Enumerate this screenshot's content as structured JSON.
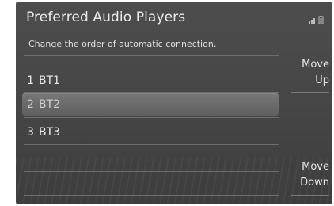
{
  "header": {
    "title": "Preferred Audio Players",
    "status_icons": [
      "signal-strength-icon",
      "battery-icon"
    ]
  },
  "instruction": "Change the order of automatic connection.",
  "players": [
    {
      "index": "1",
      "name": "BT1",
      "selected": false
    },
    {
      "index": "2",
      "name": "BT2",
      "selected": true
    },
    {
      "index": "3",
      "name": "BT3",
      "selected": false
    }
  ],
  "buttons": {
    "move_up": {
      "line1": "Move",
      "line2": "Up"
    },
    "move_down": {
      "line1": "Move",
      "line2": "Down"
    }
  },
  "colors": {
    "screen_bg": "#454545",
    "selected_row": "#6b6b6b",
    "text": "#e6e6e6"
  }
}
